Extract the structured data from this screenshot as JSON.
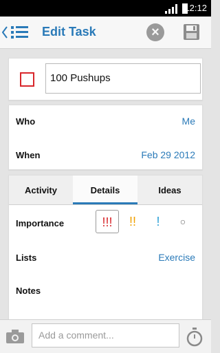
{
  "status_bar": {
    "time": "12:12"
  },
  "header": {
    "title": "Edit Task"
  },
  "task": {
    "name": "100 Pushups"
  },
  "meta": {
    "who_label": "Who",
    "who_value": "Me",
    "when_label": "When",
    "when_value": "Feb 29 2012"
  },
  "tabs": [
    {
      "label": "Activity"
    },
    {
      "label": "Details"
    },
    {
      "label": "Ideas"
    }
  ],
  "details": {
    "importance_label": "Importance",
    "importance_options": [
      "!!!",
      "!!",
      "!",
      "○"
    ],
    "importance_selected": "!!!",
    "lists_label": "Lists",
    "lists_value": "Exercise",
    "notes_label": "Notes"
  },
  "comment": {
    "placeholder": "Add a comment..."
  },
  "colors": {
    "accent": "#2a7ab8",
    "importance_high": "#d8262b",
    "importance_medium": "#f0a000",
    "importance_low": "#2a9fd6",
    "importance_none": "#666666"
  }
}
